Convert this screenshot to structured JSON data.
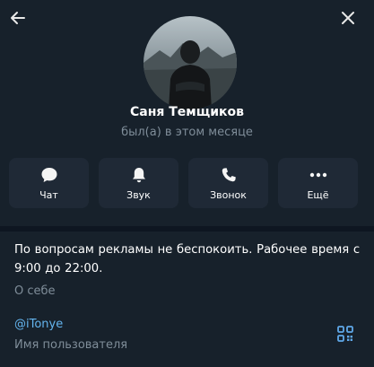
{
  "profile": {
    "name": "Саня Темщиков",
    "status": "был(а) в этом месяце"
  },
  "actions": [
    {
      "label": "Чат",
      "icon": "chat-icon"
    },
    {
      "label": "Звук",
      "icon": "bell-icon"
    },
    {
      "label": "Звонок",
      "icon": "phone-icon"
    },
    {
      "label": "Ещё",
      "icon": "more-icon"
    }
  ],
  "info": {
    "bio": "По вопросам рекламы не беспокоить. Рабочее время с 9:00 до 22:00.",
    "bio_label": "О себе",
    "username": "@iTonye",
    "username_label": "Имя пользователя"
  },
  "colors": {
    "background": "#17212b",
    "separator": "#0e1621",
    "button": "#1f2936",
    "muted_text": "#7f8d99",
    "link": "#64b5ef",
    "accent_icon": "#5fa8e8"
  },
  "icons": {
    "back": "arrow-left-icon",
    "close": "close-icon",
    "qr": "qr-code-icon"
  }
}
